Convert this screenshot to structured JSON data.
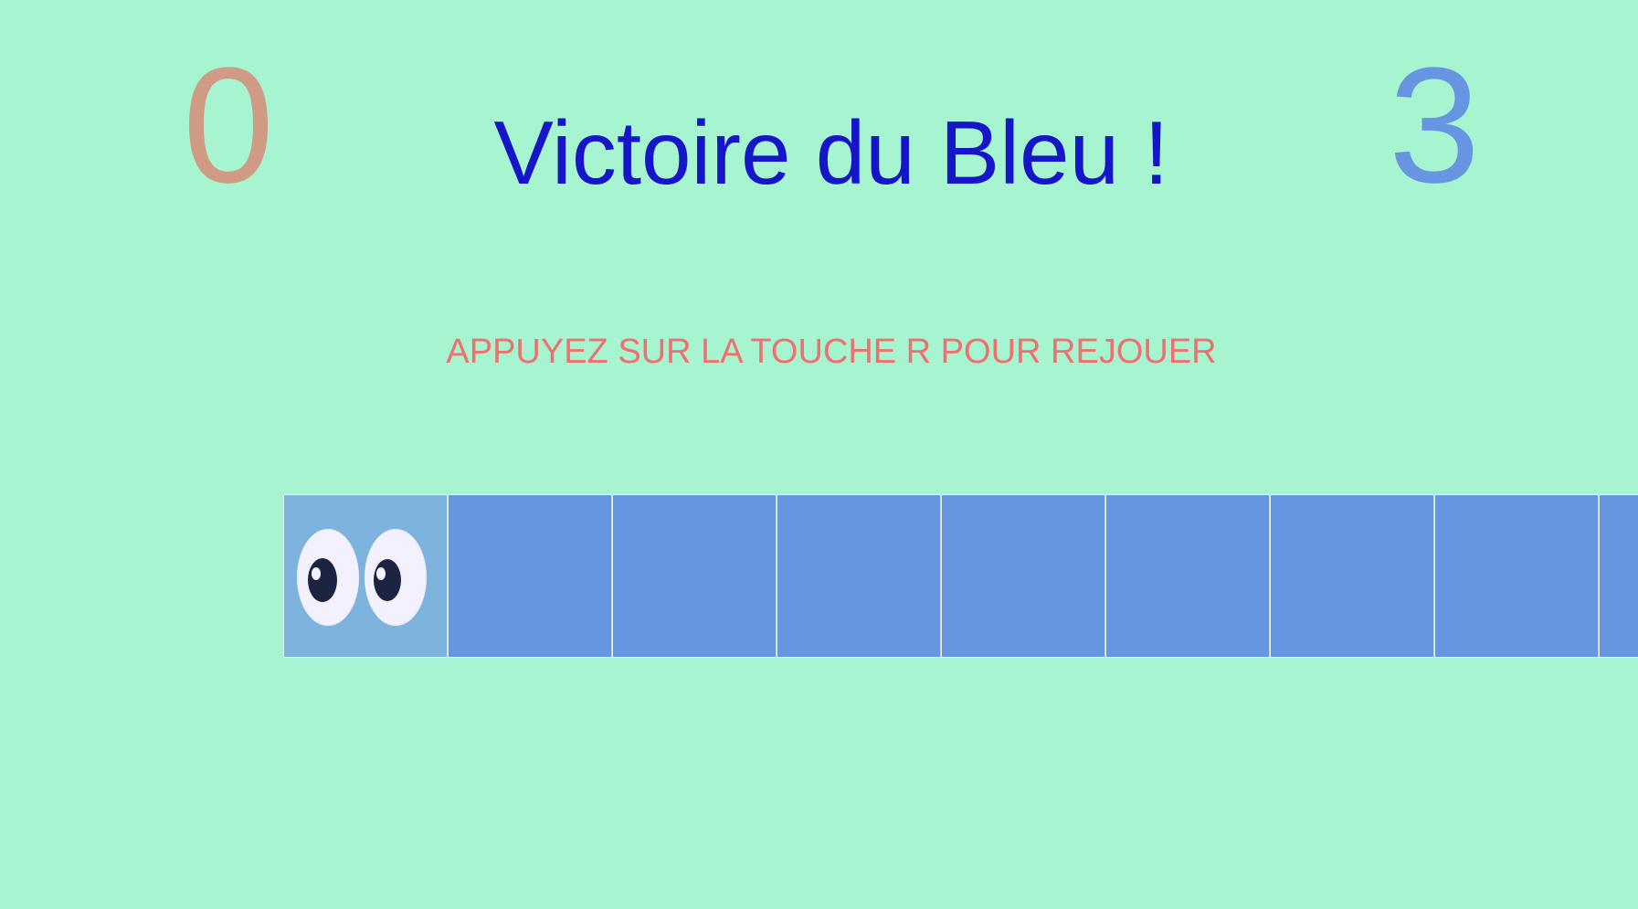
{
  "scores": {
    "left": "0",
    "right": "3"
  },
  "title": "Victoire du Bleu !",
  "hint": "APPUYEZ SUR LA TOUCHE R POUR REJOUER",
  "colors": {
    "background": "#a6f4d0",
    "left_score": "#d09b84",
    "right_score": "#6795e1",
    "title": "#1616c8",
    "hint": "#f07070",
    "tile": "#6796e1",
    "player_tile": "#7db3dc"
  },
  "track": {
    "player_icon": "googly-eyes-icon"
  }
}
